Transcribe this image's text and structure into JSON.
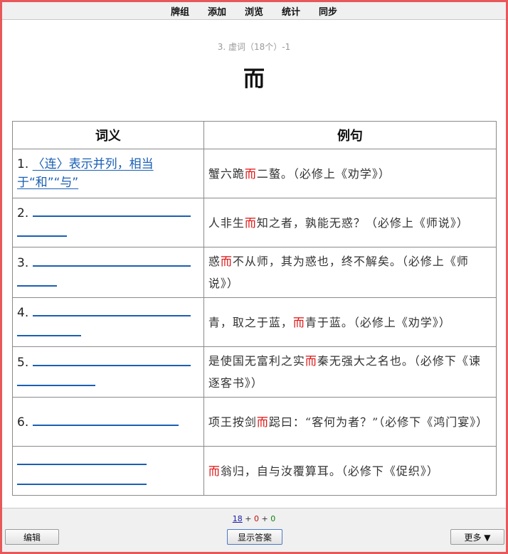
{
  "menu": [
    "牌组",
    "添加",
    "浏览",
    "统计",
    "同步"
  ],
  "card": {
    "info": "3. 虚词（18个）-1",
    "word": "而"
  },
  "table": {
    "headers": [
      "词义",
      "例句"
    ],
    "rows": [
      {
        "num": "1.",
        "answer": "〈连〉表示并列，相当于“和”“与”",
        "example": [
          {
            "t": "蟹六跪",
            "h": false
          },
          {
            "t": "而",
            "h": true
          },
          {
            "t": "二螯。（必修上《劝学》）",
            "h": false
          }
        ]
      },
      {
        "num": "2.",
        "answer": "",
        "example": [
          {
            "t": "人非生",
            "h": false
          },
          {
            "t": "而",
            "h": true
          },
          {
            "t": "知之者，孰能无惑？（必修上《师说》）",
            "h": false
          }
        ]
      },
      {
        "num": "3.",
        "answer": "",
        "example": [
          {
            "t": "惑",
            "h": false
          },
          {
            "t": "而",
            "h": true
          },
          {
            "t": "不从师，其为惑也，终不解矣。（必修上《师说》）",
            "h": false
          }
        ]
      },
      {
        "num": "4.",
        "answer": "",
        "example": [
          {
            "t": "青，取之于蓝，",
            "h": false
          },
          {
            "t": "而",
            "h": true
          },
          {
            "t": "青于蓝。（必修上《劝学》）",
            "h": false
          }
        ]
      },
      {
        "num": "5.",
        "answer": "",
        "example": [
          {
            "t": "是使国无富利之实",
            "h": false
          },
          {
            "t": "而",
            "h": true
          },
          {
            "t": "秦无强大之名也。（必修下《谏逐客书》）",
            "h": false
          }
        ]
      },
      {
        "num": "6.",
        "answer": "",
        "example": [
          {
            "t": "项王按剑",
            "h": false
          },
          {
            "t": "而",
            "h": true
          },
          {
            "t": "跽曰：“客何为者？”（必修下《鸿门宴》）",
            "h": false
          }
        ]
      },
      {
        "num": "",
        "answer": "",
        "example": [
          {
            "t": "而",
            "h": true
          },
          {
            "t": "翁归，自与汝覆算耳。（必修下《促织》）",
            "h": false
          }
        ]
      }
    ]
  },
  "footer": {
    "count_new": "18",
    "sep1": "+",
    "count_learn": "0",
    "sep2": "+",
    "count_due": "0",
    "edit_label": "编辑",
    "show_answer_label": "显示答案",
    "more_label": "更多 ▼"
  }
}
